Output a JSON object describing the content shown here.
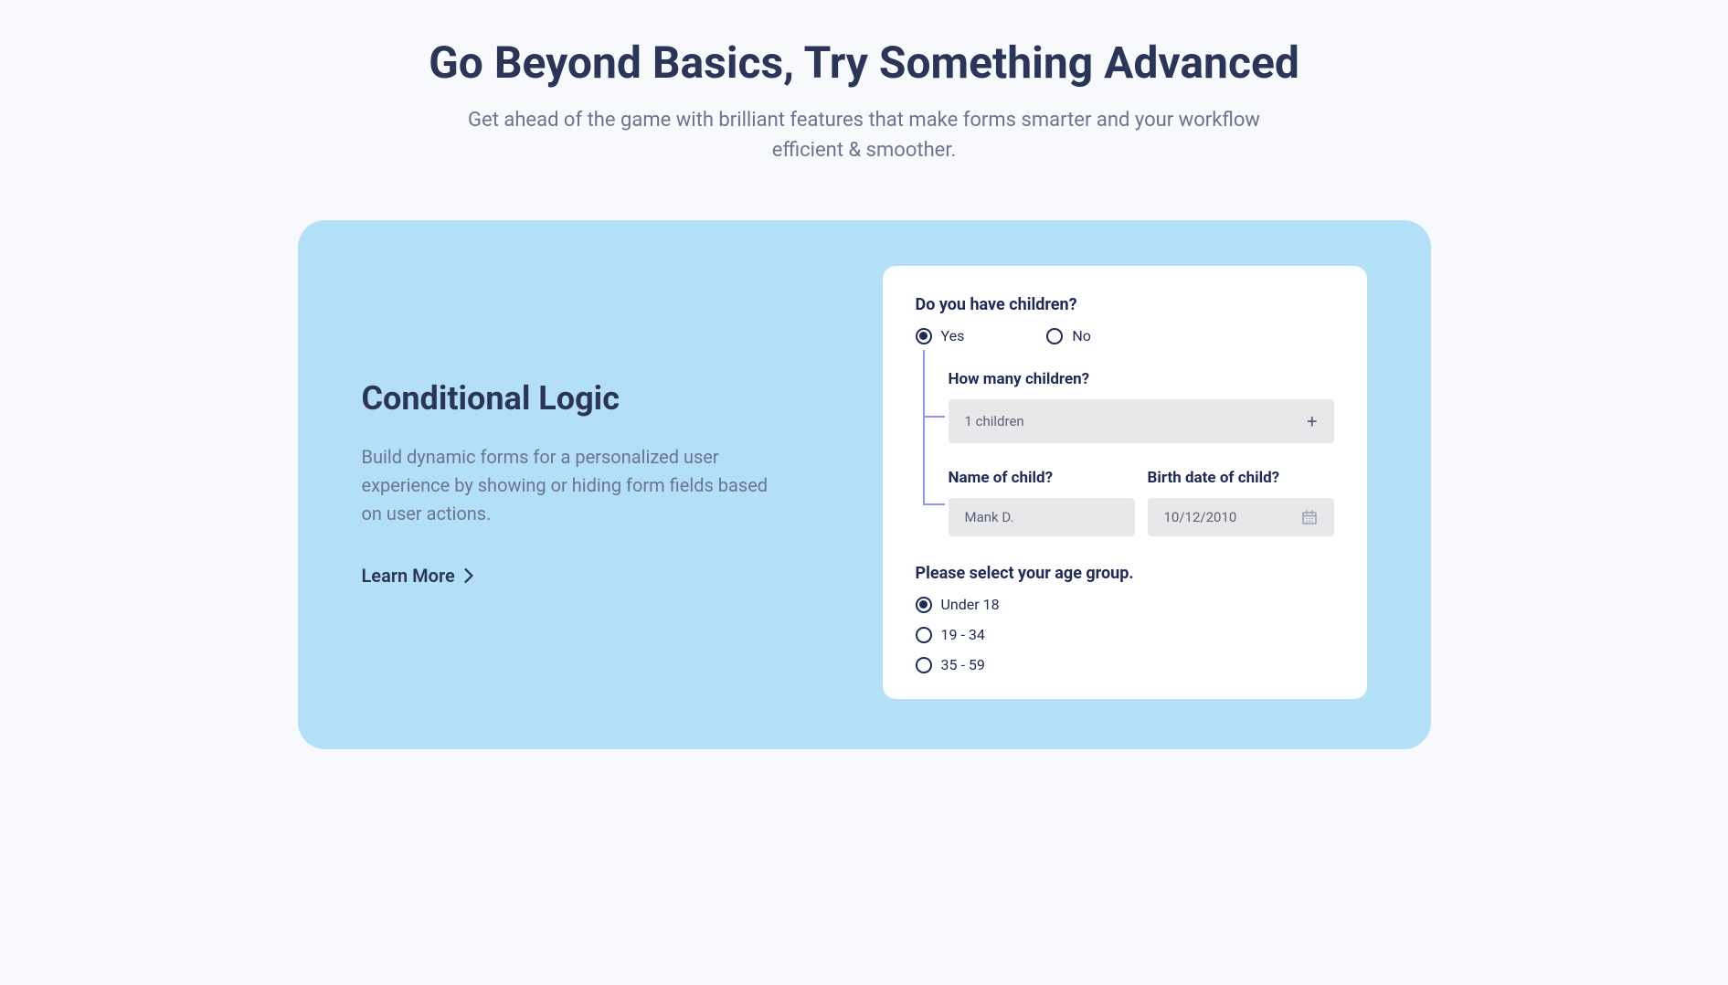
{
  "header": {
    "title": "Go Beyond Basics, Try Something Advanced",
    "subtitle": "Get ahead of the game with brilliant features that make forms smarter and your workflow efficient & smoother."
  },
  "feature": {
    "title": "Conditional Logic",
    "description": "Build dynamic forms for a personalized user experience by showing or hiding form fields based on user actions.",
    "learn_more": "Learn More"
  },
  "form": {
    "q1_label": "Do you have children?",
    "q1_options": {
      "yes": "Yes",
      "no": "No"
    },
    "q2_label": "How many children?",
    "q2_value": "1 children",
    "q2_plus": "+",
    "q3a_label": "Name of child?",
    "q3a_value": "Mank D.",
    "q3b_label": "Birth date of child?",
    "q3b_value": "10/12/2010",
    "q4_label": "Please select your age group.",
    "q4_options": {
      "under18": "Under 18",
      "r19_34": "19 - 34",
      "r35_59": "35 - 59"
    }
  }
}
